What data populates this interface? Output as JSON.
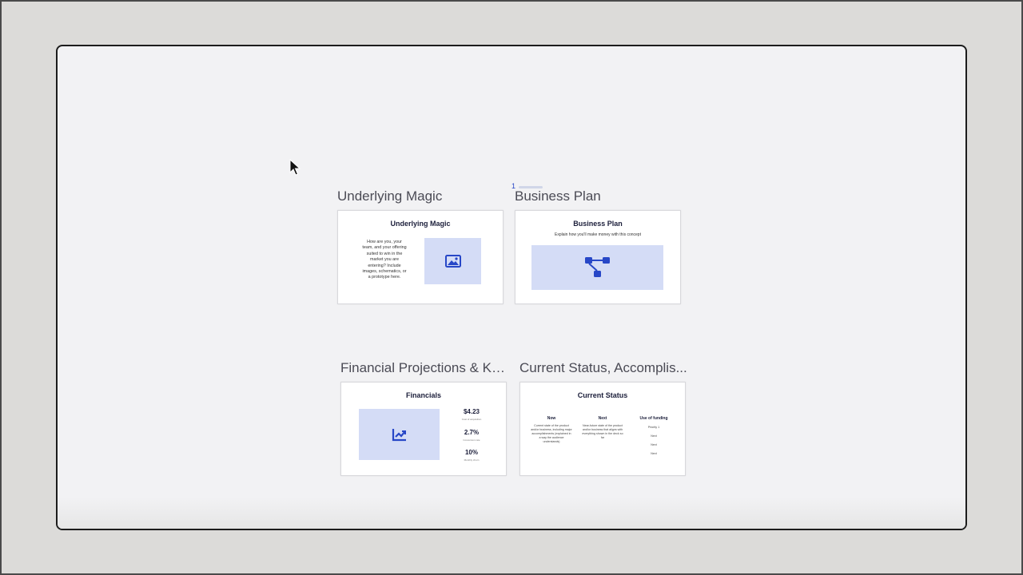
{
  "page_marker": "1",
  "slides": [
    {
      "title": "Underlying Magic",
      "heading": "Underlying Magic",
      "body": "How are you, your team, and your offering suited to win in the market you are entering? Include images, schematics, or a prototype here.",
      "icon": "image-icon"
    },
    {
      "title": "Business Plan",
      "heading": "Business Plan",
      "subtitle": "Explain how you'll make money with this concept",
      "icon": "flowchart-icon"
    },
    {
      "title": "Financial Projections & Ke...",
      "heading": "Financials",
      "icon": "chart-up-icon",
      "stats": [
        {
          "value": "$4.23",
          "label": "Cost of acquisition"
        },
        {
          "value": "2.7%",
          "label": "Conversion rate"
        },
        {
          "value": "10%",
          "label": "Monthly churn"
        }
      ]
    },
    {
      "title": "Current Status, Accomplis...",
      "heading": "Current Status",
      "columns": [
        {
          "head": "Now",
          "text": "Current state of the product and/or business, including major accomplishments (explained in a way the audience understands)"
        },
        {
          "head": "Next",
          "text": "Near-future state of the product and/or business that aligns with everything shown in the deck so far"
        },
        {
          "head": "Use of funding",
          "items": [
            "Priority 1",
            "Next",
            "Next",
            "Next"
          ]
        }
      ]
    }
  ],
  "colors": {
    "accent": "#2747c7",
    "placeholder": "#d4dcf6",
    "heading": "#1b1e3a"
  }
}
